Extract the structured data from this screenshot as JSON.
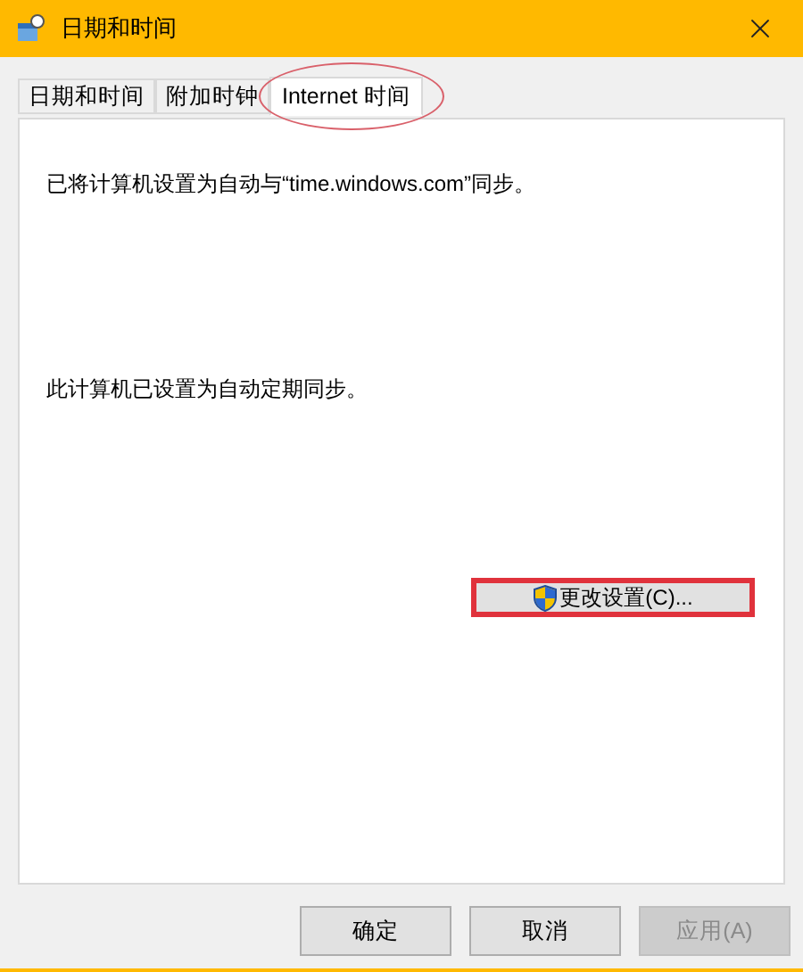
{
  "window": {
    "title": "日期和时间"
  },
  "tabs": [
    {
      "label": "日期和时间",
      "selected": false,
      "circled": false
    },
    {
      "label": "附加时钟",
      "selected": false,
      "circled": false
    },
    {
      "label": "Internet 时间",
      "selected": true,
      "circled": true
    }
  ],
  "sync_message": "已将计算机设置为自动与“time.windows.com”同步。",
  "schedule_message": "此计算机已设置为自动定期同步。",
  "change_button": {
    "label": "更改设置(C)...",
    "highlighted": true
  },
  "buttons": [
    {
      "label": "确定",
      "disabled": false
    },
    {
      "label": "取消",
      "disabled": false
    },
    {
      "label": "应用(A)",
      "disabled": true
    }
  ]
}
